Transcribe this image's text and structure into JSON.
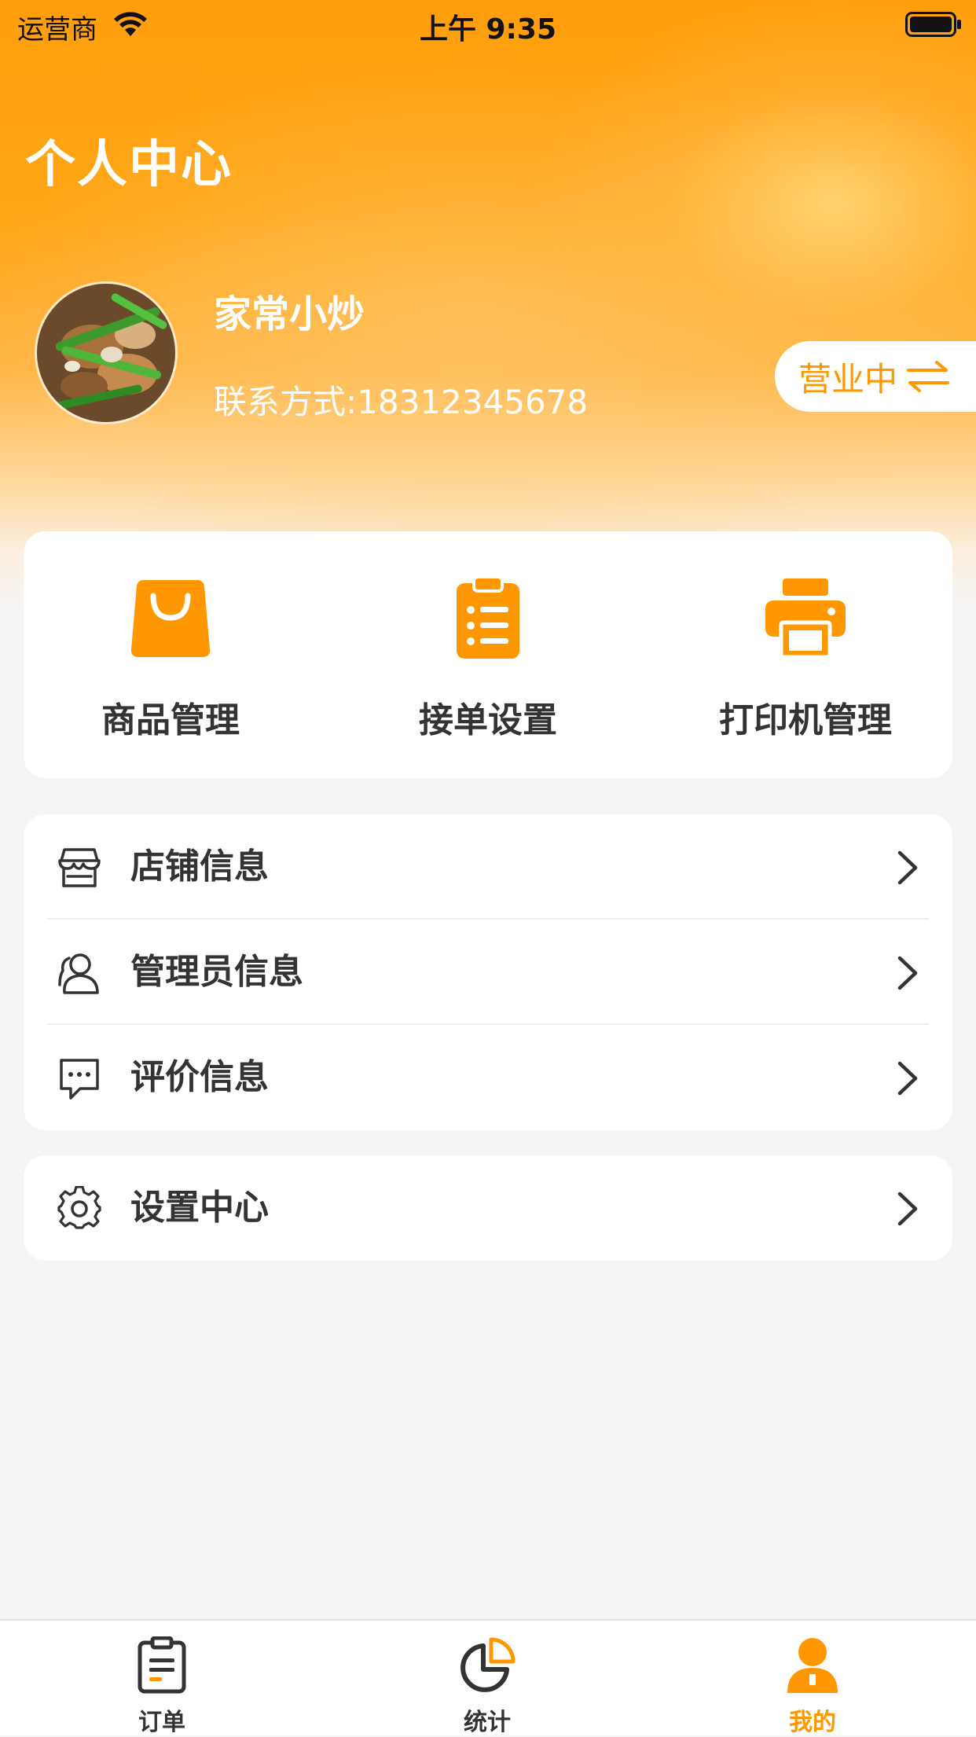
{
  "colors": {
    "accent": "#ff9800",
    "text_primary": "#333333",
    "background": "#f4f5f7",
    "header_gradient_top": "#ff9e0c"
  },
  "status_bar": {
    "carrier": "运营商",
    "time": "上午 9:35"
  },
  "header": {
    "title": "个人中心"
  },
  "profile": {
    "shop_name": "家常小炒",
    "contact": "联系方式:18312345678",
    "business_status": "营业中"
  },
  "quick_actions": [
    {
      "label": "商品管理",
      "icon": "shopping-bag-icon"
    },
    {
      "label": "接单设置",
      "icon": "clipboard-list-icon"
    },
    {
      "label": "打印机管理",
      "icon": "printer-icon"
    }
  ],
  "menu_group_1": [
    {
      "label": "店铺信息",
      "icon": "store-icon"
    },
    {
      "label": "管理员信息",
      "icon": "users-icon"
    },
    {
      "label": "评价信息",
      "icon": "comment-icon"
    }
  ],
  "menu_group_2": [
    {
      "label": "设置中心",
      "icon": "gear-icon"
    }
  ],
  "tab_bar": {
    "active": "我的",
    "items": [
      {
        "label": "订单",
        "icon": "order-clipboard-icon"
      },
      {
        "label": "统计",
        "icon": "pie-chart-icon"
      },
      {
        "label": "我的",
        "icon": "person-icon"
      }
    ]
  }
}
